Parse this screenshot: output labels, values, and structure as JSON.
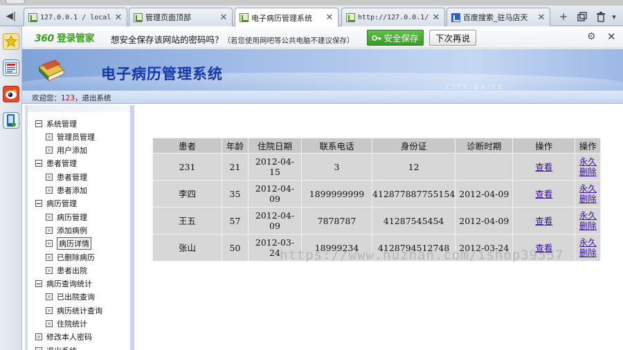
{
  "browser": {
    "tabs": [
      {
        "label": "127.0.0.1 / local",
        "mono": true,
        "active": false
      },
      {
        "label": "管理页面顶部",
        "mono": false,
        "active": false
      },
      {
        "label": "电子病历管理系统",
        "mono": false,
        "active": true
      },
      {
        "label": "http://127.0.0.1/",
        "mono": true,
        "active": false
      },
      {
        "label": "百度搜索_驻马店天",
        "mono": false,
        "active": false,
        "icon": "paw"
      }
    ],
    "close_glyph": "✕",
    "new_tab_glyph": "+",
    "trash_glyph": "🗑",
    "dropdown_glyph": "▾"
  },
  "password_bar": {
    "brand_number": "360",
    "brand_text": "登录管家",
    "question": "想安全保存该网站的密码吗？",
    "note": "（若您使用网吧等公共电脑不建议保存）",
    "save_label": "安全保存",
    "later_label": "下次再说",
    "gear_glyph": "⚙",
    "close_glyph": "✕"
  },
  "header": {
    "title": "电子病历管理系统",
    "faint_text": "CITY BAITE"
  },
  "welcome": {
    "prefix": "欢迎您：",
    "user": "123",
    "suffix": "，退出系统"
  },
  "sidebar": [
    {
      "label": "系统管理",
      "type": "group"
    },
    {
      "label": "管理员管理",
      "type": "leaf"
    },
    {
      "label": "用户添加",
      "type": "leaf"
    },
    {
      "label": "患者管理",
      "type": "group"
    },
    {
      "label": "患者管理",
      "type": "leaf"
    },
    {
      "label": "患者添加",
      "type": "leaf"
    },
    {
      "label": "病历管理",
      "type": "group"
    },
    {
      "label": "病历管理",
      "type": "leaf"
    },
    {
      "label": "添加病例",
      "type": "leaf"
    },
    {
      "label": "病历详情",
      "type": "leaf",
      "selected": true
    },
    {
      "label": "已删除病历",
      "type": "leaf"
    },
    {
      "label": "患者出院",
      "type": "leaf"
    },
    {
      "label": "病历查询统计",
      "type": "group"
    },
    {
      "label": "已出院查询",
      "type": "leaf"
    },
    {
      "label": "病历统计查询",
      "type": "leaf"
    },
    {
      "label": "住院统计",
      "type": "leaf"
    },
    {
      "label": "修改本人密码",
      "type": "root"
    },
    {
      "label": "退出系统",
      "type": "root"
    }
  ],
  "table": {
    "headers": [
      "患者",
      "年龄",
      "住院日期",
      "联系电话",
      "身份证",
      "诊断时期",
      "操作",
      "操作"
    ],
    "rows": [
      {
        "name": "231",
        "age": "21",
        "date_line1": "2012-04-",
        "date_line2": "15",
        "phone": "3",
        "id_card": "12",
        "diag_date": "",
        "view": "查看",
        "delete_line1": "永久",
        "delete_line2": "删除"
      },
      {
        "name": "李四",
        "age": "35",
        "date_line1": "2012-04-",
        "date_line2": "09",
        "phone": "1899999999",
        "id_card": "412877887755154",
        "diag_date": "2012-04-09",
        "view": "查看",
        "delete_line1": "永久",
        "delete_line2": "删除"
      },
      {
        "name": "王五",
        "age": "57",
        "date_line1": "2012-04-",
        "date_line2": "09",
        "phone": "7878787",
        "id_card": "41287545454",
        "diag_date": "2012-04-09",
        "view": "查看",
        "delete_line1": "永久",
        "delete_line2": "删除"
      },
      {
        "name": "张山",
        "age": "50",
        "date_line1": "2012-03-",
        "date_line2": "24",
        "phone": "18999234",
        "id_card": "4128794512748",
        "diag_date": "2012-03-24",
        "view": "查看",
        "delete_line1": "永久",
        "delete_line2": "删除"
      }
    ]
  },
  "watermark": "https://www.huzhan.com/ishop39557"
}
